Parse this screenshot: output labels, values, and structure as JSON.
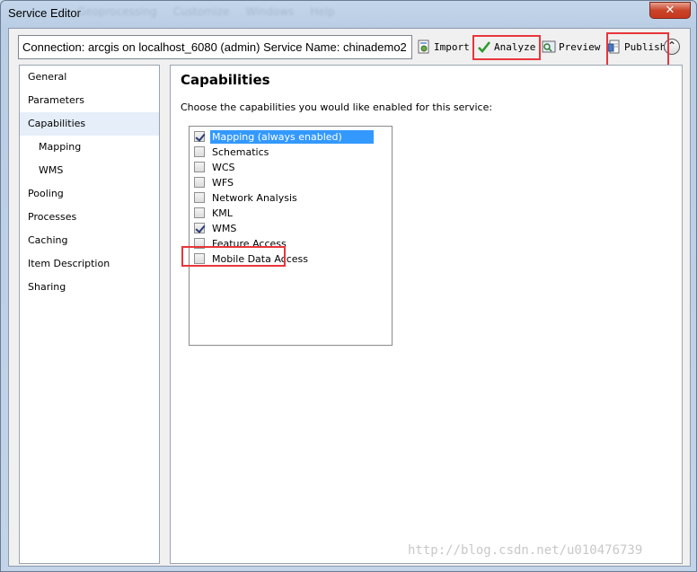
{
  "window": {
    "title": "Service Editor",
    "close_label": "✕"
  },
  "ghost_menu": [
    "Geoprocessing",
    "Customize",
    "Windows",
    "Help"
  ],
  "toolbar": {
    "connection_text": "Connection: arcgis on localhost_6080 (admin)   Service Name: chinademo2",
    "import_label": "Import",
    "analyze_label": "Analyze",
    "preview_label": "Preview",
    "publish_label": "Publish",
    "collapse_label": "⌃"
  },
  "sidebar": {
    "items": [
      {
        "label": "General",
        "sub": false,
        "active": false
      },
      {
        "label": "Parameters",
        "sub": false,
        "active": false
      },
      {
        "label": "Capabilities",
        "sub": false,
        "active": true
      },
      {
        "label": "Mapping",
        "sub": true,
        "active": false
      },
      {
        "label": "WMS",
        "sub": true,
        "active": false
      },
      {
        "label": "Pooling",
        "sub": false,
        "active": false
      },
      {
        "label": "Processes",
        "sub": false,
        "active": false
      },
      {
        "label": "Caching",
        "sub": false,
        "active": false
      },
      {
        "label": "Item Description",
        "sub": false,
        "active": false
      },
      {
        "label": "Sharing",
        "sub": false,
        "active": false
      }
    ]
  },
  "main": {
    "title": "Capabilities",
    "description": "Choose the capabilities you would like enabled for this service:",
    "capabilities": [
      {
        "label": "Mapping (always enabled)",
        "checked": true,
        "selected": true
      },
      {
        "label": "Schematics",
        "checked": false,
        "selected": false
      },
      {
        "label": "WCS",
        "checked": false,
        "selected": false
      },
      {
        "label": "WFS",
        "checked": false,
        "selected": false
      },
      {
        "label": "Network Analysis",
        "checked": false,
        "selected": false
      },
      {
        "label": "KML",
        "checked": false,
        "selected": false
      },
      {
        "label": "WMS",
        "checked": true,
        "selected": false
      },
      {
        "label": "Feature Access",
        "checked": false,
        "selected": false
      },
      {
        "label": "Mobile Data Access",
        "checked": false,
        "selected": false
      }
    ]
  },
  "watermark": "http://blog.csdn.net/u010476739",
  "colors": {
    "highlight": "#e8353b",
    "selection": "#3399ff",
    "close": "#c7381d"
  }
}
